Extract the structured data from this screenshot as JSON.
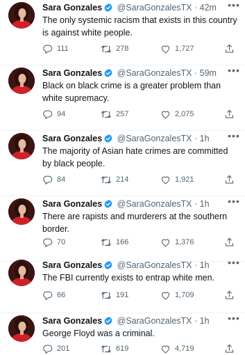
{
  "user": {
    "name": "Sara Gonzales",
    "handle": "@SaraGonzalesTX",
    "verified_color": "#1d9bf0"
  },
  "icons": {
    "reply": "speech-bubble-icon",
    "retweet": "retweet-arrows-icon",
    "like": "heart-icon",
    "share": "share-upload-icon",
    "more": "more-dots-icon"
  },
  "more_label": "•••",
  "dot": "·",
  "tweets": [
    {
      "time": "42m",
      "text": "The only systemic racism that exists in this country is against white people.",
      "replies": "111",
      "retweets": "278",
      "likes": "1,727"
    },
    {
      "time": "59m",
      "text": "Black on black crime is a greater problem than white supremacy.",
      "replies": "94",
      "retweets": "257",
      "likes": "2,075"
    },
    {
      "time": "1h",
      "text": "The majority of Asian hate crimes are committed by black people.",
      "replies": "84",
      "retweets": "214",
      "likes": "1,921"
    },
    {
      "time": "1h",
      "text": "There are rapists and murderers at the southern border.",
      "replies": "70",
      "retweets": "166",
      "likes": "1,376"
    },
    {
      "time": "1h",
      "text": "The FBI currently exists to entrap white men.",
      "replies": "66",
      "retweets": "191",
      "likes": "1,709"
    },
    {
      "time": "1h",
      "text": "George Floyd was a criminal.",
      "replies": "201",
      "retweets": "619",
      "likes": "4,719"
    }
  ]
}
